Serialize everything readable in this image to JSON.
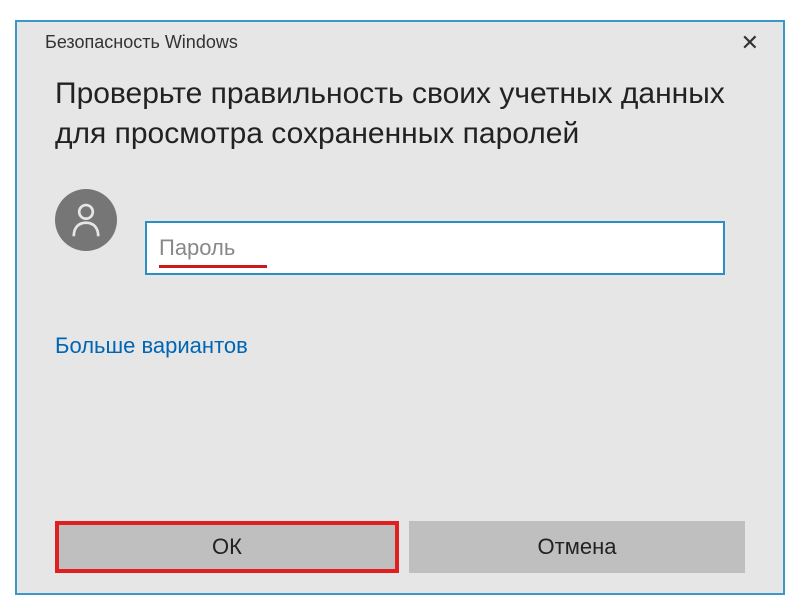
{
  "dialog": {
    "title": "Безопасность Windows",
    "heading": "Проверьте правильность своих учетных данных для просмотра сохраненных паролей",
    "password_placeholder": "Пароль",
    "more_options": "Больше вариантов",
    "ok_label": "ОК",
    "cancel_label": "Отмена"
  }
}
